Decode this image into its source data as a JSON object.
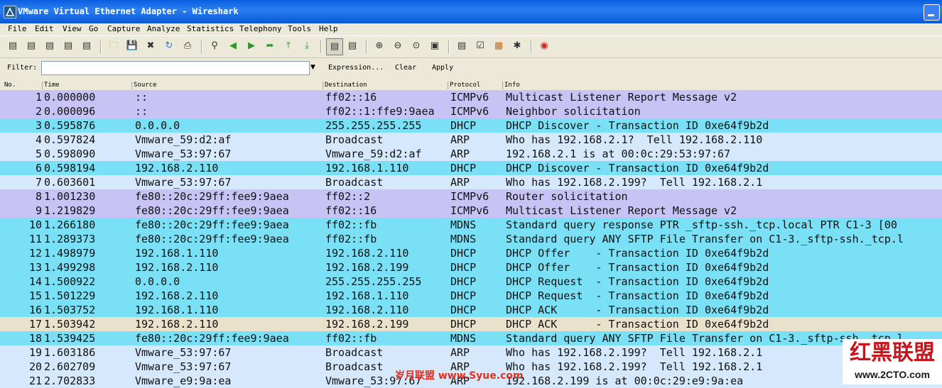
{
  "window": {
    "title": "VMware Virtual Ethernet Adapter - Wireshark"
  },
  "menu": [
    "File",
    "Edit",
    "View",
    "Go",
    "Capture",
    "Analyze",
    "Statistics",
    "Telephony",
    "Tools",
    "Help"
  ],
  "filter": {
    "label": "Filter:",
    "value": "",
    "expression": "Expression...",
    "clear": "Clear",
    "apply": "Apply"
  },
  "columns": [
    "No.",
    "Time",
    "Source",
    "Destination",
    "Protocol",
    "Info"
  ],
  "colors": {
    "icmpv6": "#c7c3f5",
    "dhcp": "#79e0f5",
    "arp": "#d6e8fb",
    "mdns": "#79e0f5",
    "selected": "#e8e2cc"
  },
  "packets": [
    {
      "no": "1",
      "time": "0.000000",
      "src": "::",
      "dst": "ff02::16",
      "proto": "ICMPv6",
      "info": "Multicast Listener Report Message v2",
      "color": "icmpv6"
    },
    {
      "no": "2",
      "time": "0.000096",
      "src": "::",
      "dst": "ff02::1:ffe9:9aea",
      "proto": "ICMPv6",
      "info": "Neighbor solicitation",
      "color": "icmpv6"
    },
    {
      "no": "3",
      "time": "0.595876",
      "src": "0.0.0.0",
      "dst": "255.255.255.255",
      "proto": "DHCP",
      "info": "DHCP Discover - Transaction ID 0xe64f9b2d",
      "color": "dhcp"
    },
    {
      "no": "4",
      "time": "0.597824",
      "src": "Vmware_59:d2:af",
      "dst": "Broadcast",
      "proto": "ARP",
      "info": "Who has 192.168.2.1?  Tell 192.168.2.110",
      "color": "arp"
    },
    {
      "no": "5",
      "time": "0.598090",
      "src": "Vmware_53:97:67",
      "dst": "Vmware_59:d2:af",
      "proto": "ARP",
      "info": "192.168.2.1 is at 00:0c:29:53:97:67",
      "color": "arp"
    },
    {
      "no": "6",
      "time": "0.598194",
      "src": "192.168.2.110",
      "dst": "192.168.1.110",
      "proto": "DHCP",
      "info": "DHCP Discover - Transaction ID 0xe64f9b2d",
      "color": "dhcp"
    },
    {
      "no": "7",
      "time": "0.603601",
      "src": "Vmware_53:97:67",
      "dst": "Broadcast",
      "proto": "ARP",
      "info": "Who has 192.168.2.199?  Tell 192.168.2.1",
      "color": "arp"
    },
    {
      "no": "8",
      "time": "1.001230",
      "src": "fe80::20c:29ff:fee9:9aea",
      "dst": "ff02::2",
      "proto": "ICMPv6",
      "info": "Router solicitation",
      "color": "icmpv6"
    },
    {
      "no": "9",
      "time": "1.219829",
      "src": "fe80::20c:29ff:fee9:9aea",
      "dst": "ff02::16",
      "proto": "ICMPv6",
      "info": "Multicast Listener Report Message v2",
      "color": "icmpv6"
    },
    {
      "no": "10",
      "time": "1.266180",
      "src": "fe80::20c:29ff:fee9:9aea",
      "dst": "ff02::fb",
      "proto": "MDNS",
      "info": "Standard query response PTR _sftp-ssh._tcp.local PTR C1-3 [00",
      "color": "mdns"
    },
    {
      "no": "11",
      "time": "1.289373",
      "src": "fe80::20c:29ff:fee9:9aea",
      "dst": "ff02::fb",
      "proto": "MDNS",
      "info": "Standard query ANY SFTP File Transfer on C1-3._sftp-ssh._tcp.l",
      "color": "mdns"
    },
    {
      "no": "12",
      "time": "1.498979",
      "src": "192.168.1.110",
      "dst": "192.168.2.110",
      "proto": "DHCP",
      "info": "DHCP Offer    - Transaction ID 0xe64f9b2d",
      "color": "dhcp"
    },
    {
      "no": "13",
      "time": "1.499298",
      "src": "192.168.2.110",
      "dst": "192.168.2.199",
      "proto": "DHCP",
      "info": "DHCP Offer    - Transaction ID 0xe64f9b2d",
      "color": "dhcp"
    },
    {
      "no": "14",
      "time": "1.500922",
      "src": "0.0.0.0",
      "dst": "255.255.255.255",
      "proto": "DHCP",
      "info": "DHCP Request  - Transaction ID 0xe64f9b2d",
      "color": "dhcp"
    },
    {
      "no": "15",
      "time": "1.501229",
      "src": "192.168.2.110",
      "dst": "192.168.1.110",
      "proto": "DHCP",
      "info": "DHCP Request  - Transaction ID 0xe64f9b2d",
      "color": "dhcp"
    },
    {
      "no": "16",
      "time": "1.503752",
      "src": "192.168.1.110",
      "dst": "192.168.2.110",
      "proto": "DHCP",
      "info": "DHCP ACK      - Transaction ID 0xe64f9b2d",
      "color": "dhcp"
    },
    {
      "no": "17",
      "time": "1.503942",
      "src": "192.168.2.110",
      "dst": "192.168.2.199",
      "proto": "DHCP",
      "info": "DHCP ACK      - Transaction ID 0xe64f9b2d",
      "color": "selected"
    },
    {
      "no": "18",
      "time": "1.539425",
      "src": "fe80::20c:29ff:fee9:9aea",
      "dst": "ff02::fb",
      "proto": "MDNS",
      "info": "Standard query ANY SFTP File Transfer on C1-3._sftp-ssh._tcp.l",
      "color": "mdns"
    },
    {
      "no": "19",
      "time": "1.603186",
      "src": "Vmware_53:97:67",
      "dst": "Broadcast",
      "proto": "ARP",
      "info": "Who has 192.168.2.199?  Tell 192.168.2.1",
      "color": "arp"
    },
    {
      "no": "20",
      "time": "2.602709",
      "src": "Vmware_53:97:67",
      "dst": "Broadcast",
      "proto": "ARP",
      "info": "Who has 192.168.2.199?  Tell 192.168.2.1",
      "color": "arp"
    },
    {
      "no": "21",
      "time": "2.702833",
      "src": "Vmware_e9:9a:ea",
      "dst": "Vmware_53:97:67",
      "proto": "ARP",
      "info": "192.168.2.199 is at 00:0c:29:e9:9a:ea",
      "color": "arp"
    }
  ],
  "watermarks": {
    "site_cn": "岁月联盟",
    "site_url": "www.Syue.com",
    "brand_cn": "红黑联盟",
    "brand_url": "www.2CTO.com"
  }
}
